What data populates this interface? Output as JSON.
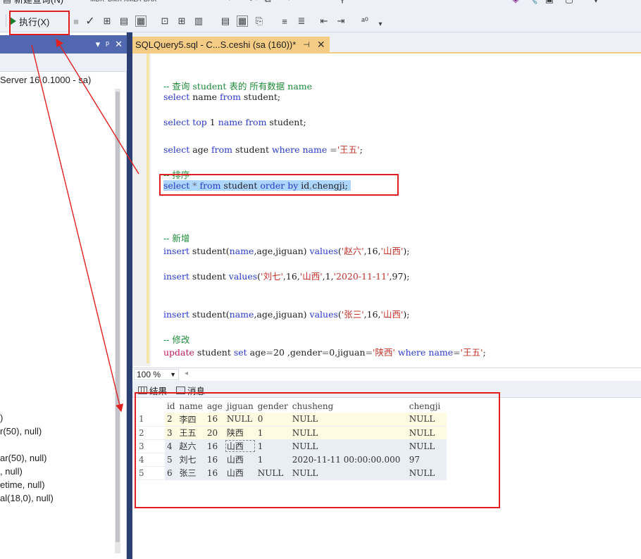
{
  "toolbar": {
    "new_query_label": "新建查询(N)",
    "execute_label": "执行(X)",
    "icon_names": [
      "new-query-icon",
      "play-icon",
      "check-icon",
      "parse-icon",
      "results-to-grid-icon",
      "results-to-text-icon",
      "comment-icon",
      "indent-icon",
      "find-icon"
    ]
  },
  "explorer": {
    "server_label": "Server 16.0.1000 - sa)",
    "column_fragments": [
      ")",
      "r(50), null)",
      "ar(50), null)",
      ", null)",
      "etime, null)",
      "al(18,0), null)"
    ]
  },
  "tab": {
    "title": "SQLQuery5.sql - C...S.ceshi (sa (160))*",
    "pin_icon": "pin-icon",
    "close_icon": "close-icon"
  },
  "editor": {
    "lines": [
      {
        "id": "l1",
        "text": "-- 查询 student 表的 所有数据 name"
      },
      {
        "id": "l2",
        "text": "select name from student;"
      },
      {
        "id": "l3",
        "text": "select top 1 name from student;"
      },
      {
        "id": "l4",
        "text": "select age from student where name ='王五';"
      },
      {
        "id": "l5",
        "text": "-- 排序"
      },
      {
        "id": "l6",
        "text": "select * from student order by id,chengji;"
      },
      {
        "id": "l7",
        "text": "-- 新增"
      },
      {
        "id": "l8",
        "text": "insert student(name,age,jiguan) values('赵六',16,'山西');"
      },
      {
        "id": "l9",
        "text": "insert student values('刘七',16,'山西',1,'2020-11-11',97);"
      },
      {
        "id": "l10",
        "text": "insert student(name,age,jiguan) values('张三',16,'山西');"
      },
      {
        "id": "l11",
        "text": "-- 修改"
      },
      {
        "id": "l12",
        "text": "update student set age=20 ,gender=0,jiguan='陕西' where name='王五';"
      }
    ]
  },
  "zoom": {
    "value": "100 %"
  },
  "results_tabs": {
    "results_label": "结果",
    "messages_label": "消息"
  },
  "results": {
    "columns": [
      "id",
      "name",
      "age",
      "jiguan",
      "gender",
      "chusheng",
      "chengji"
    ],
    "rows": [
      {
        "rownum": "1",
        "id": "2",
        "name": "李四",
        "age": "16",
        "jiguan": "NULL",
        "gender": "0",
        "chusheng": "NULL",
        "chengji": "NULL"
      },
      {
        "rownum": "2",
        "id": "3",
        "name": "王五",
        "age": "20",
        "jiguan": "陕西",
        "gender": "1",
        "chusheng": "NULL",
        "chengji": "NULL"
      },
      {
        "rownum": "3",
        "id": "4",
        "name": "赵六",
        "age": "16",
        "jiguan": "山西",
        "gender": "1",
        "chusheng": "NULL",
        "chengji": "NULL"
      },
      {
        "rownum": "4",
        "id": "5",
        "name": "刘七",
        "age": "16",
        "jiguan": "山西",
        "gender": "1",
        "chusheng": "2020-11-11 00:00:00.000",
        "chengji": "97"
      },
      {
        "rownum": "5",
        "id": "6",
        "name": "张三",
        "age": "16",
        "jiguan": "山西",
        "gender": "NULL",
        "chusheng": "NULL",
        "chengji": "NULL"
      }
    ]
  },
  "colors": {
    "annotation": "#e02020",
    "tab_active": "#f5cc84",
    "keyword": "#2a39c9",
    "string": "#c0332b",
    "comment": "#1f8a3a",
    "selection": "#add6ff"
  }
}
